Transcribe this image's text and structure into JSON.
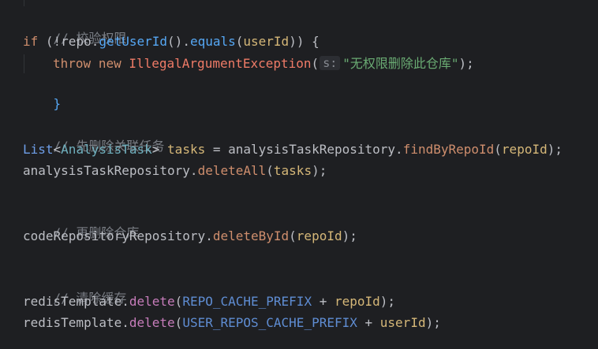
{
  "code": {
    "comment_validate": "// 校验权限",
    "if_kw": "if",
    "if_open": " (!",
    "repo_obj": "repo",
    "dot": ".",
    "get_user_id": "getUserId",
    "call_empty": "()",
    "equals": "equals",
    "open_paren": "(",
    "user_id": "userId",
    "close_if": ")) {",
    "throw_kw": "throw",
    "new_kw": "new",
    "exception_class": "IllegalArgumentException",
    "hint_s": "s:",
    "message": "\"无权限删除此仓库\"",
    "close_throw": ");",
    "close_brace": "}",
    "comment_tasks": "// 先删除关联任务",
    "list_type": "List",
    "lt": "<",
    "analysis_task": "AnalysisTask",
    "gt": ">",
    "tasks_var": "tasks",
    "assign": " = ",
    "analysis_repo": "analysisTaskRepository",
    "find_by_repo_id": "findByRepoId",
    "repo_id": "repoId",
    "delete_all": "deleteAll",
    "tasks_arg": "tasks",
    "comment_repo": "// 再删除仓库",
    "code_repo": "codeRepositoryRepository",
    "delete_by_id": "deleteById",
    "comment_cache": "// 清除缓存",
    "redis": "redisTemplate",
    "delete_method": "delete",
    "repo_cache_prefix": "REPO_CACHE_PREFIX",
    "plus": " + ",
    "user_repos_cache_prefix": "USER_REPOS_CACHE_PREFIX"
  }
}
